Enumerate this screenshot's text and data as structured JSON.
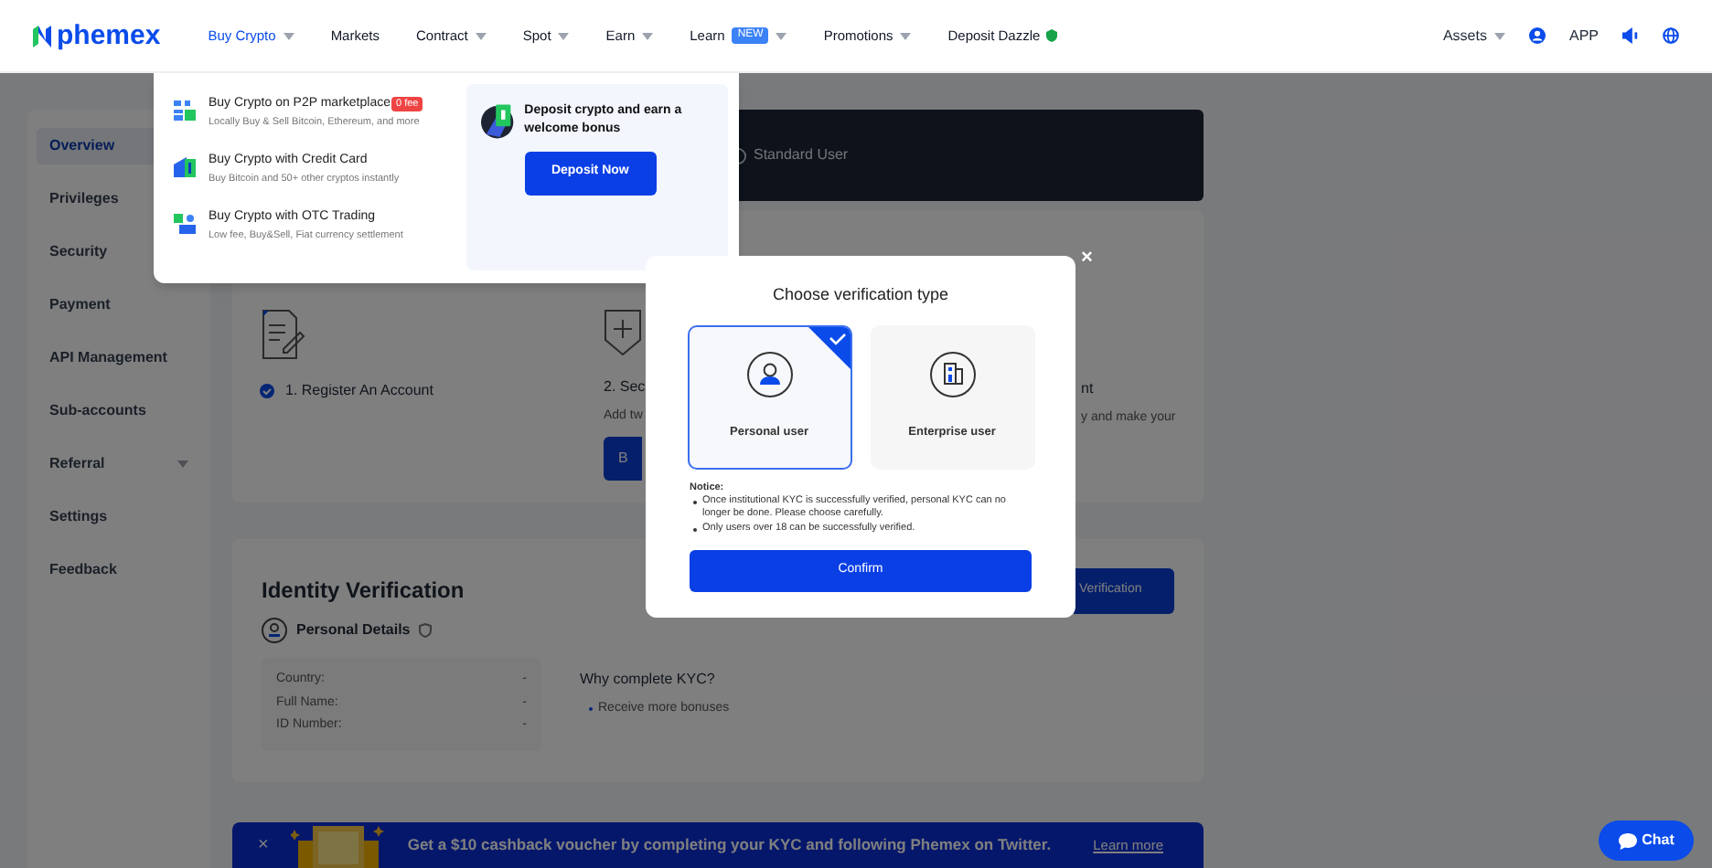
{
  "nav": {
    "logo": "phemex",
    "items": [
      {
        "label": "Buy Crypto",
        "dropdown": true,
        "selected": true
      },
      {
        "label": "Markets",
        "dropdown": false,
        "selected": false
      },
      {
        "label": "Contract",
        "dropdown": true,
        "selected": false
      },
      {
        "label": "Spot",
        "dropdown": true,
        "selected": false
      },
      {
        "label": "Earn",
        "dropdown": true,
        "selected": false
      },
      {
        "label": "Learn",
        "badge": "NEW",
        "dropdown": true,
        "selected": false
      },
      {
        "label": "Promotions",
        "dropdown": true,
        "selected": false
      },
      {
        "label": "Deposit Dazzle",
        "dropdown": false,
        "selected": false
      }
    ],
    "assets": "Assets",
    "app": "APP"
  },
  "sidebar": {
    "items": [
      {
        "label": "Overview",
        "selected": true,
        "expandable": false
      },
      {
        "label": "Privileges",
        "selected": false,
        "expandable": false
      },
      {
        "label": "Security",
        "selected": false,
        "expandable": false
      },
      {
        "label": "Payment",
        "selected": false,
        "expandable": false
      },
      {
        "label": "API Management",
        "selected": false,
        "expandable": false
      },
      {
        "label": "Sub-accounts",
        "selected": false,
        "expandable": false
      },
      {
        "label": "Referral",
        "selected": false,
        "expandable": true
      },
      {
        "label": "Settings",
        "selected": false,
        "expandable": false
      },
      {
        "label": "Feedback",
        "selected": false,
        "expandable": false
      }
    ]
  },
  "account_card": {
    "level": "Standard User"
  },
  "steps": {
    "step_1": {
      "label": "1. Register An Account",
      "done": true
    },
    "left_fragments": {
      "title": "2. Sec",
      "text": "Add tw",
      "button": "B"
    },
    "right_fragments": {
      "title": "nt",
      "text": "y and make your"
    }
  },
  "identity": {
    "title": "Identity Verification",
    "button_fragment": "Verification",
    "personal_details": "Personal Details",
    "details": [
      {
        "label": "Country:",
        "value": "-"
      },
      {
        "label": "Full Name:",
        "value": "-"
      },
      {
        "label": "ID Number:",
        "value": "-"
      }
    ],
    "why_title": "Why complete KYC?",
    "bullets": [
      "Receive more bonuses"
    ]
  },
  "promo_banner": {
    "close": "×",
    "text": "Get a $10 cashback voucher by completing your KYC and following Phemex on Twitter.",
    "link": "Learn more"
  },
  "chat": "Chat",
  "buy_menu": {
    "items": [
      {
        "title": "Buy Crypto on P2P marketplace",
        "badge": "0 fee",
        "description": "Locally Buy & Sell Bitcoin, Ethereum, and more"
      },
      {
        "title": "Buy Crypto with Credit Card",
        "description": "Buy Bitcoin and 50+ other cryptos instantly"
      },
      {
        "title": "Buy Crypto with OTC Trading",
        "description": "Low fee, Buy&Sell, Fiat currency settlement"
      }
    ],
    "promo": {
      "title": "Deposit crypto and earn a welcome bonus",
      "button": "Deposit Now"
    }
  },
  "modal": {
    "close": "×",
    "title": "Choose verification type",
    "options": [
      {
        "kind": "personal",
        "label": "Personal user",
        "selected": true
      },
      {
        "kind": "enterprise",
        "label": "Enterprise user",
        "selected": false
      }
    ],
    "notice_title": "Notice:",
    "notices": [
      "Once institutional KYC is successfully verified, personal KYC can no longer be done. Please choose carefully.",
      "Only users over 18 can be successfully verified."
    ],
    "confirm": "Confirm"
  }
}
